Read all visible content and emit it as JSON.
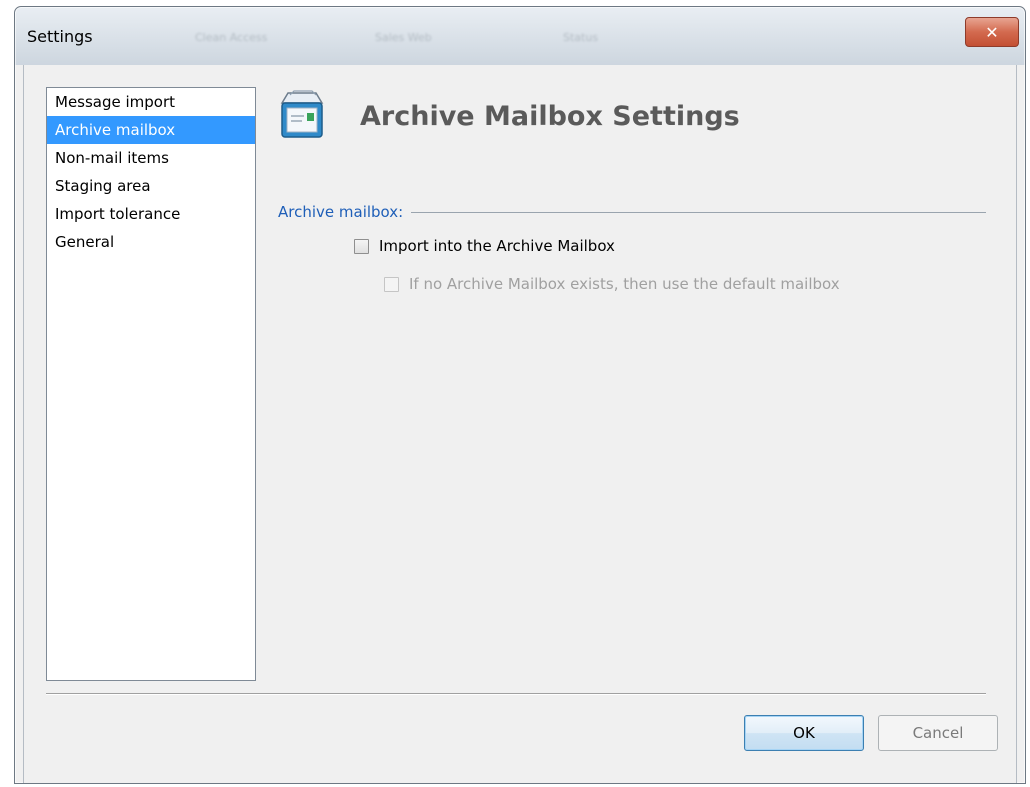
{
  "window": {
    "title": "Settings",
    "ghost_menu": [
      "Clean Access",
      "Sales Web",
      "Status"
    ],
    "close_glyph": "✕"
  },
  "sidebar": {
    "items": [
      {
        "label": "Message import",
        "selected": false
      },
      {
        "label": "Archive mailbox",
        "selected": true
      },
      {
        "label": "Non-mail items",
        "selected": false
      },
      {
        "label": "Staging area",
        "selected": false
      },
      {
        "label": "Import tolerance",
        "selected": false
      },
      {
        "label": "General",
        "selected": false
      }
    ]
  },
  "page": {
    "icon": "mailbox-settings-icon",
    "title": "Archive Mailbox Settings"
  },
  "section": {
    "label": "Archive mailbox:",
    "options": [
      {
        "label": "Import into the Archive Mailbox",
        "checked": false,
        "enabled": true
      },
      {
        "label": "If no Archive Mailbox exists, then use the default mailbox",
        "checked": false,
        "enabled": false
      }
    ]
  },
  "buttons": {
    "ok": "OK",
    "cancel": "Cancel"
  },
  "colors": {
    "selection": "#3399ff",
    "section_label": "#1f5fb8",
    "title_text": "#5a5a5a"
  }
}
